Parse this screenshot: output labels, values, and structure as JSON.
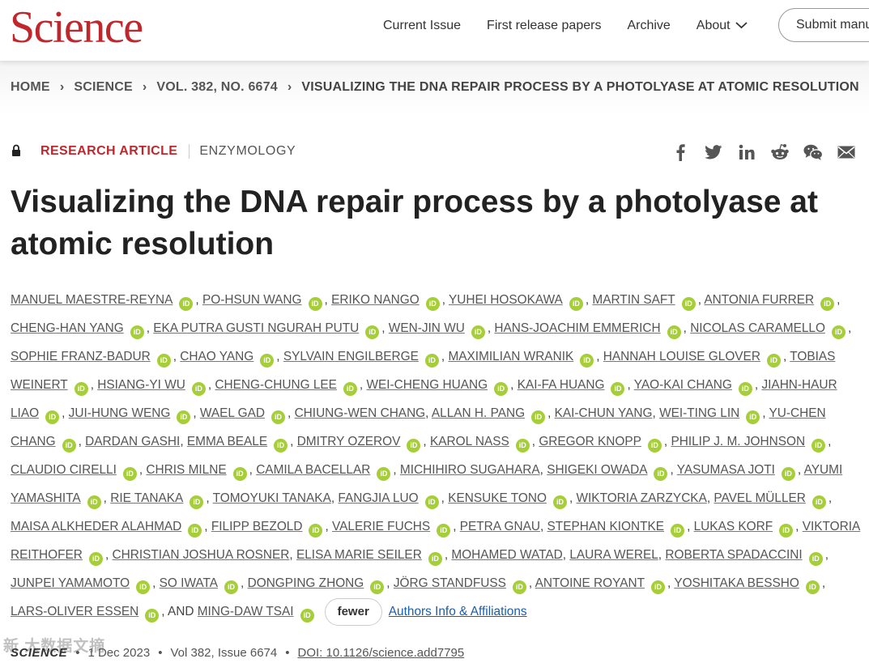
{
  "header": {
    "logo": "Science",
    "nav": [
      "Current Issue",
      "First release papers",
      "Archive",
      "About"
    ],
    "submit_label": "Submit manuscript"
  },
  "breadcrumb": [
    "HOME",
    "SCIENCE",
    "VOL. 382, NO. 6674",
    "VISUALIZING THE DNA REPAIR PROCESS BY A PHOTOLYASE AT ATOMIC RESOLUTION"
  ],
  "meta": {
    "article_type": "RESEARCH ARTICLE",
    "subject": "ENZYMOLOGY"
  },
  "share_icons": [
    "facebook-icon",
    "twitter-icon",
    "linkedin-icon",
    "reddit-icon",
    "wechat-icon",
    "email-icon"
  ],
  "title": "Visualizing the DNA repair process by a photolyase at atomic resolution",
  "authors": [
    {
      "name": "MANUEL MAESTRE-REYNA",
      "orcid": true,
      "sep": ", "
    },
    {
      "name": "PO-HSUN WANG",
      "orcid": true,
      "sep": ", "
    },
    {
      "name": "ERIKO NANGO",
      "orcid": true,
      "sep": ", "
    },
    {
      "name": "YUHEI HOSOKAWA",
      "orcid": true,
      "sep": ", "
    },
    {
      "name": "MARTIN SAFT",
      "orcid": true,
      "sep": ", "
    },
    {
      "name": "ANTONIA FURRER",
      "orcid": true,
      "sep": ", "
    },
    {
      "name": "CHENG-HAN YANG",
      "orcid": true,
      "sep": ", "
    },
    {
      "name": "EKA PUTRA GUSTI NGURAH PUTU",
      "orcid": true,
      "sep": ", "
    },
    {
      "name": "WEN-JIN WU",
      "orcid": true,
      "sep": ", "
    },
    {
      "name": "HANS-JOACHIM EMMERICH",
      "orcid": true,
      "sep": ", "
    },
    {
      "name": "NICOLAS CARAMELLO",
      "orcid": true,
      "sep": ", "
    },
    {
      "name": "SOPHIE FRANZ-BADUR",
      "orcid": true,
      "sep": ", "
    },
    {
      "name": "CHAO YANG",
      "orcid": true,
      "sep": ", "
    },
    {
      "name": "SYLVAIN ENGILBERGE",
      "orcid": true,
      "sep": ", "
    },
    {
      "name": "MAXIMILIAN WRANIK",
      "orcid": true,
      "sep": ", "
    },
    {
      "name": "HANNAH LOUISE GLOVER",
      "orcid": true,
      "sep": ", "
    },
    {
      "name": "TOBIAS WEINERT",
      "orcid": true,
      "sep": ", "
    },
    {
      "name": "HSIANG-YI WU",
      "orcid": true,
      "sep": ", "
    },
    {
      "name": "CHENG-CHUNG LEE",
      "orcid": true,
      "sep": ", "
    },
    {
      "name": "WEI-CHENG HUANG",
      "orcid": true,
      "sep": ", "
    },
    {
      "name": "KAI-FA HUANG",
      "orcid": true,
      "sep": ", "
    },
    {
      "name": "YAO-KAI CHANG",
      "orcid": true,
      "sep": ", "
    },
    {
      "name": "JIAHN-HAUR LIAO",
      "orcid": true,
      "sep": ", "
    },
    {
      "name": "JUI-HUNG WENG",
      "orcid": true,
      "sep": ", "
    },
    {
      "name": "WAEL GAD",
      "orcid": true,
      "sep": ", "
    },
    {
      "name": "CHIUNG-WEN CHANG",
      "orcid": false,
      "sep": ", "
    },
    {
      "name": "ALLAN H. PANG",
      "orcid": true,
      "sep": ", "
    },
    {
      "name": "KAI-CHUN YANG",
      "orcid": false,
      "sep": ", "
    },
    {
      "name": "WEI-TING LIN",
      "orcid": true,
      "sep": ", "
    },
    {
      "name": "YU-CHEN CHANG",
      "orcid": true,
      "sep": ", "
    },
    {
      "name": "DARDAN GASHI",
      "orcid": false,
      "sep": ", "
    },
    {
      "name": "EMMA BEALE",
      "orcid": true,
      "sep": ", "
    },
    {
      "name": "DMITRY OZEROV",
      "orcid": true,
      "sep": ", "
    },
    {
      "name": "KAROL NASS",
      "orcid": true,
      "sep": ", "
    },
    {
      "name": "GREGOR KNOPP",
      "orcid": true,
      "sep": ", "
    },
    {
      "name": "PHILIP J. M. JOHNSON",
      "orcid": true,
      "sep": ", "
    },
    {
      "name": "CLAUDIO CIRELLI",
      "orcid": true,
      "sep": ", "
    },
    {
      "name": "CHRIS MILNE",
      "orcid": true,
      "sep": ", "
    },
    {
      "name": "CAMILA BACELLAR",
      "orcid": true,
      "sep": ", "
    },
    {
      "name": "MICHIHIRO SUGAHARA",
      "orcid": false,
      "sep": ", "
    },
    {
      "name": "SHIGEKI OWADA",
      "orcid": true,
      "sep": ", "
    },
    {
      "name": "YASUMASA JOTI",
      "orcid": true,
      "sep": ", "
    },
    {
      "name": "AYUMI YAMASHITA",
      "orcid": true,
      "sep": ", "
    },
    {
      "name": "RIE TANAKA",
      "orcid": true,
      "sep": ", "
    },
    {
      "name": "TOMOYUKI TANAKA",
      "orcid": false,
      "sep": ", "
    },
    {
      "name": "FANGJIA LUO",
      "orcid": true,
      "sep": ", "
    },
    {
      "name": "KENSUKE TONO",
      "orcid": true,
      "sep": ", "
    },
    {
      "name": "WIKTORIA ZARZYCKA",
      "orcid": false,
      "sep": ", "
    },
    {
      "name": "PAVEL MÜLLER",
      "orcid": true,
      "sep": ", "
    },
    {
      "name": "MAISA ALKHEDER ALAHMAD",
      "orcid": true,
      "sep": ", "
    },
    {
      "name": "FILIPP BEZOLD",
      "orcid": true,
      "sep": ", "
    },
    {
      "name": "VALERIE FUCHS",
      "orcid": true,
      "sep": ", "
    },
    {
      "name": "PETRA GNAU",
      "orcid": false,
      "sep": ", "
    },
    {
      "name": "STEPHAN KIONTKE",
      "orcid": true,
      "sep": ", "
    },
    {
      "name": "LUKAS KORF",
      "orcid": true,
      "sep": ", "
    },
    {
      "name": "VIKTORIA REITHOFER",
      "orcid": true,
      "sep": ", "
    },
    {
      "name": "CHRISTIAN JOSHUA ROSNER",
      "orcid": false,
      "sep": ", "
    },
    {
      "name": "ELISA MARIE SEILER",
      "orcid": true,
      "sep": ", "
    },
    {
      "name": "MOHAMED WATAD",
      "orcid": false,
      "sep": ", "
    },
    {
      "name": "LAURA WEREL",
      "orcid": false,
      "sep": ", "
    },
    {
      "name": "ROBERTA SPADACCINI",
      "orcid": true,
      "sep": ", "
    },
    {
      "name": "JUNPEI YAMAMOTO",
      "orcid": true,
      "sep": ", "
    },
    {
      "name": "SO IWATA",
      "orcid": true,
      "sep": ", "
    },
    {
      "name": "DONGPING ZHONG",
      "orcid": true,
      "sep": ", "
    },
    {
      "name": "JÖRG STANDFUSS",
      "orcid": true,
      "sep": ", "
    },
    {
      "name": "ANTOINE ROYANT",
      "orcid": true,
      "sep": ", "
    },
    {
      "name": "YOSHITAKA BESSHO",
      "orcid": true,
      "sep": ", "
    },
    {
      "name": "LARS-OLIVER ESSEN",
      "orcid": true,
      "sep": ", AND "
    },
    {
      "name": "MING-DAW TSAI",
      "orcid": true,
      "sep": ""
    }
  ],
  "orcid_label": "iD",
  "fewer_label": "fewer",
  "affiliations_link": "Authors Info & Affiliations",
  "citation": {
    "journal": "SCIENCE",
    "date": "1 Dec 2023",
    "volume": "Vol 382, Issue 6674",
    "doi": "DOI: 10.1126/science.add7795"
  },
  "watermark": "新 大数据文摘"
}
